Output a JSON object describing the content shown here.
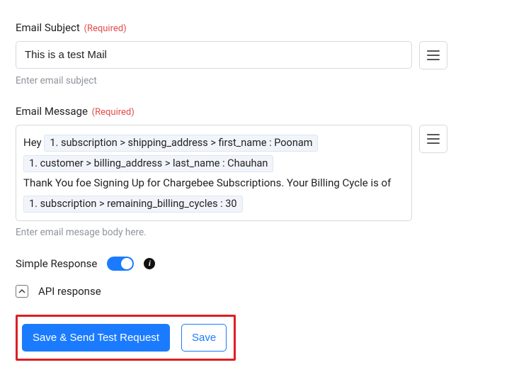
{
  "subject": {
    "label": "Email Subject",
    "required_text": "(Required)",
    "value": "This is a test Mail",
    "helper": "Enter email subject"
  },
  "message": {
    "label": "Email Message",
    "required_text": "(Required)",
    "helper": "Enter email mesage body here.",
    "text_hey": "Hey ",
    "token_firstname": "1. subscription > shipping_address > first_name : Poonam",
    "token_lastname": "1. customer > billing_address > last_name : Chauhan",
    "text_thank": "Thank You foe Signing Up for Chargebee Subscriptions. Your Billing Cycle is of ",
    "token_cycles": "1. subscription > remaining_billing_cycles : 30"
  },
  "simple_response": {
    "label": "Simple Response"
  },
  "api_response": {
    "label": "API response"
  },
  "buttons": {
    "primary": "Save & Send Test Request",
    "secondary": "Save"
  }
}
